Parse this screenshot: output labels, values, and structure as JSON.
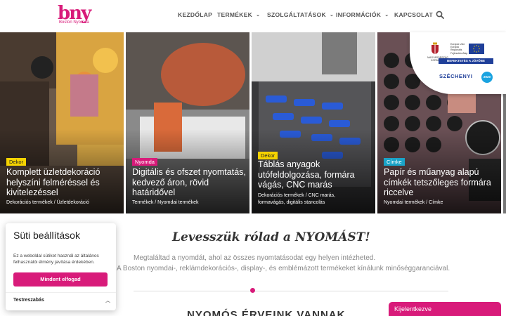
{
  "brand": {
    "logo_text": "bny",
    "logo_sub": "Boston Nyomda",
    "accent": "#d81b7a"
  },
  "nav": {
    "items": [
      {
        "label": "KEZDŐLAP",
        "has_dropdown": false
      },
      {
        "label": "TERMÉKEK",
        "has_dropdown": true
      },
      {
        "label": "SZOLGÁLTATÁSOK",
        "has_dropdown": true
      },
      {
        "label": "INFORMÁCIÓK",
        "has_dropdown": true
      },
      {
        "label": "KAPCSOLAT",
        "has_dropdown": false
      }
    ],
    "search_icon": "search-icon"
  },
  "eu_badge": {
    "hu_text": "MAGYARORSZÁG KORMÁNYA",
    "eu_text": "Európai Unió Európai Regionális Fejlesztési Alap",
    "invest": "BEFEKTETÉS A JÖVŐBE",
    "szechenyi": "SZÉCHENYI",
    "year": "2020"
  },
  "cards": [
    {
      "tag": "Dekor",
      "title": "Komplett üzletdekoráció helyszíni felméréssel és kivitelezéssel",
      "links": "Dekorációs termékek / Üzletdekoráció",
      "tag_color": "#f5d300"
    },
    {
      "tag": "Nyomda",
      "title": "Digitális és ofszet nyomtatás, kedvező áron, rövid határidővel",
      "links": "Termékek / Nyomdai termékek",
      "tag_color": "#d81b7a"
    },
    {
      "tag": "Dekor",
      "title": "Táblás anyagok utófeldolgozása, formára vágás, CNC marás",
      "links": "Dekorációs termékek / CNC marás, formavágás, digitális stancolás",
      "tag_color": "#f5d300"
    },
    {
      "tag": "Címke",
      "title": "Papír és műanyag alapú címkék tetszőleges formára riccelve",
      "links": "Nyomdai termékek / Címke",
      "tag_color": "#1aa3c8"
    }
  ],
  "main": {
    "tagline": "Levesszük rólad a NYOMÁST!",
    "desc1": "Megtaláltad a nyomdát, ahol az összes nyomtatásodat egy helyen intézheted.",
    "desc2": "A Boston nyomdai-, reklámdekorációs-, display-, és emblémázott termékeket kínálunk minőséggaranciával.",
    "bottom_heading": "NYOMÓS ÉRVEINK VANNAK"
  },
  "cookie": {
    "title": "Süti beállítások",
    "text": "Ez a weboldal sütiket használ az általános felhasználói élmény javítása érdekében.",
    "accept": "Mindent elfogad",
    "customize": "Testreszabás"
  },
  "contact_tab": {
    "label": "Kijelentkezve"
  }
}
